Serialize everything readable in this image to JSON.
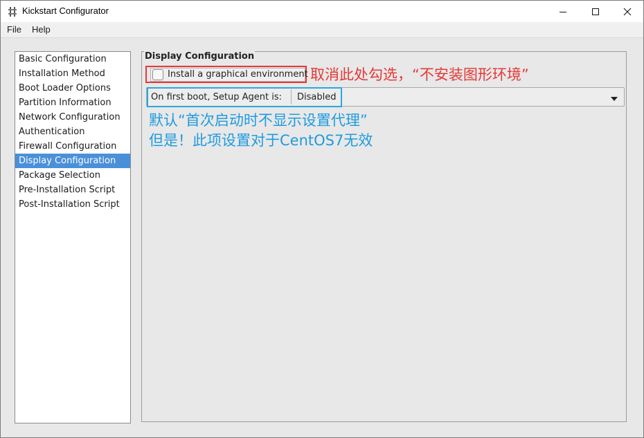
{
  "window": {
    "title": "Kickstart Configurator",
    "controls": [
      "minimize",
      "maximize",
      "close"
    ]
  },
  "menu": {
    "file": "File",
    "help": "Help"
  },
  "sidebar": {
    "selected_index": 7,
    "items": [
      {
        "label": "Basic Configuration"
      },
      {
        "label": "Installation Method"
      },
      {
        "label": "Boot Loader Options"
      },
      {
        "label": "Partition Information"
      },
      {
        "label": "Network Configuration"
      },
      {
        "label": "Authentication"
      },
      {
        "label": "Firewall Configuration"
      },
      {
        "label": "Display Configuration"
      },
      {
        "label": "Package Selection"
      },
      {
        "label": "Pre-Installation Script"
      },
      {
        "label": "Post-Installation Script"
      }
    ]
  },
  "panel": {
    "title": "Display Configuration",
    "graphical_checkbox": {
      "label": "Install a graphical environment",
      "checked": false
    },
    "setup_agent": {
      "label": "On first boot, Setup Agent is:",
      "value": "Disabled"
    }
  },
  "annotations": {
    "red": "取消此处勾选，“不安装图形环境”",
    "blue_line1": "默认“首次启动时不显示设置代理”",
    "blue_line2": "但是！此项设置对于CentOS7无效"
  },
  "colors": {
    "selection": "#4a90d9",
    "annotation_red": "#e53935",
    "annotation_blue": "#1e9be0"
  }
}
